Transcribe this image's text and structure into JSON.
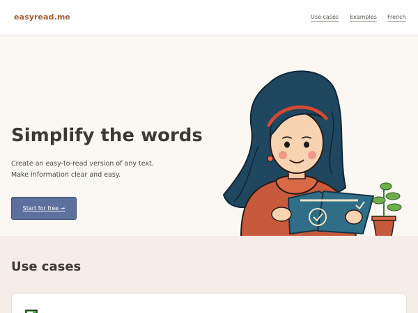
{
  "header": {
    "logo": "easyread.me",
    "nav": [
      "Use cases",
      "Examples",
      "French"
    ]
  },
  "hero": {
    "title": "Simplify the words",
    "lines": [
      "Create an easy-to-read version of any text.",
      "Make information clear and easy."
    ],
    "cta_label": "Start for free →"
  },
  "use_cases": {
    "title": "Use cases"
  },
  "colors": {
    "accent_logo": "#a55a32",
    "button": "#5d6f9c",
    "hero_bg": "#fbf8f3",
    "section_bg": "#f5ede7"
  }
}
